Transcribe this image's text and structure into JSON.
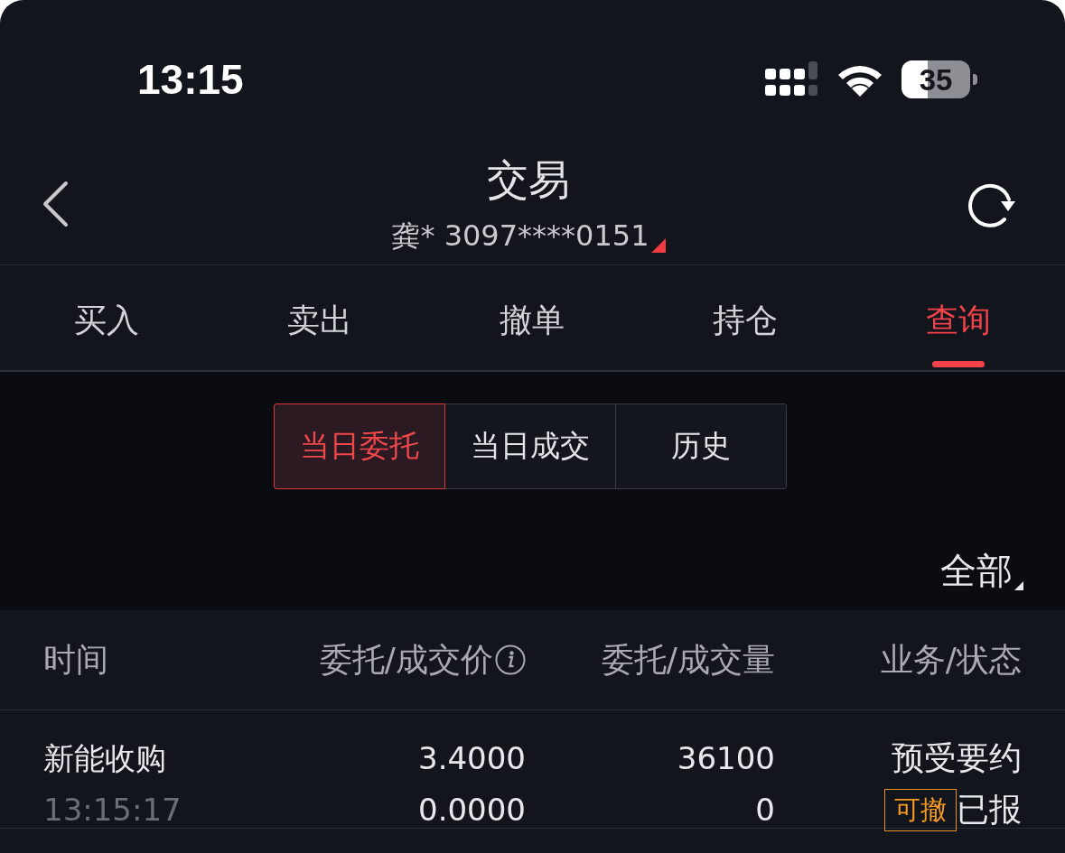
{
  "status_bar": {
    "time": "13:15",
    "battery": "35"
  },
  "header": {
    "title": "交易",
    "account": "龚* 3097****0151"
  },
  "tabs": [
    {
      "label": "买入",
      "selected": false
    },
    {
      "label": "卖出",
      "selected": false
    },
    {
      "label": "撤单",
      "selected": false
    },
    {
      "label": "持仓",
      "selected": false
    },
    {
      "label": "查询",
      "selected": true
    }
  ],
  "segments": [
    {
      "label": "当日委托",
      "selected": true
    },
    {
      "label": "当日成交",
      "selected": false
    },
    {
      "label": "历史",
      "selected": false
    }
  ],
  "filter": {
    "label": "全部"
  },
  "table": {
    "columns": [
      {
        "label": "时间",
        "info": false
      },
      {
        "label": "委托/成交价",
        "info": true
      },
      {
        "label": "委托/成交量",
        "info": false
      },
      {
        "label": "业务/状态",
        "info": false
      }
    ],
    "rows": [
      {
        "name": "新能收购",
        "time": "13:15:17",
        "price": "3.4000",
        "filled_price": "0.0000",
        "quantity": "36100",
        "filled_quantity": "0",
        "business": "预受要约",
        "cancel_tag": "可撤",
        "status": "已报"
      }
    ]
  }
}
